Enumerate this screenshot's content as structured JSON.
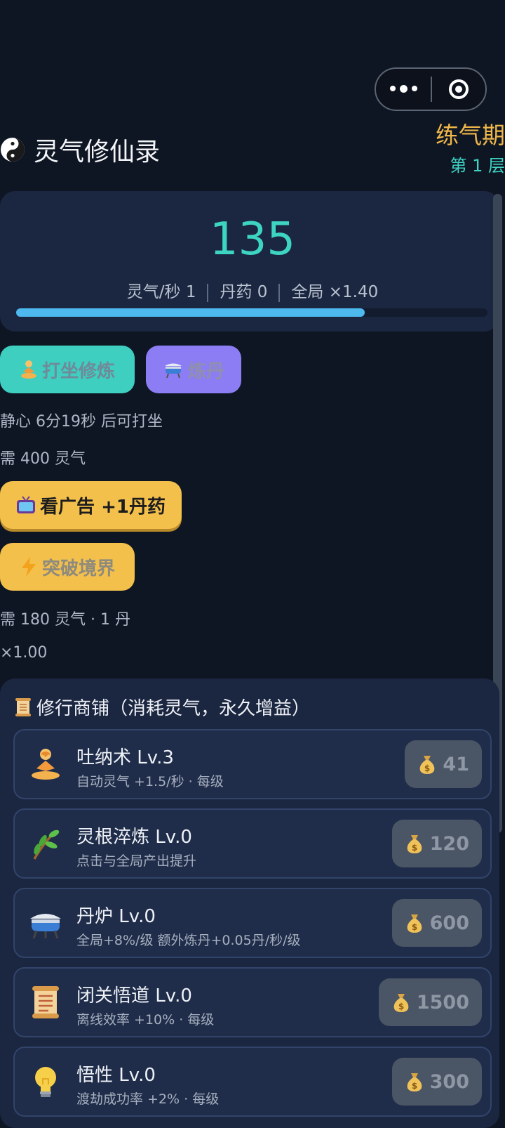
{
  "header": {
    "app_icon": "yin-yang-icon",
    "title": "灵气修仙录",
    "realm": "练气期",
    "layer": "第 1 层"
  },
  "stats": {
    "qi": "135",
    "qi_rate": "灵气/秒 1",
    "pills": "丹药 0",
    "global_multiplier": "全局 ×1.40",
    "progress": 0.74
  },
  "actions": {
    "meditate": "打坐修炼",
    "alchemy": "炼丹",
    "meditate_cooldown": "静心 6分19秒 后可打坐",
    "alchemy_cost": "需 400 灵气",
    "watch_ad": "看广告 +1丹药",
    "breakthrough": "突破境界",
    "breakthrough_cost": "需 180 灵气 · 1 丹",
    "breakthrough_multiplier": "×1.00"
  },
  "shop": {
    "title": "修行商铺（消耗灵气，永久增益）",
    "items": [
      {
        "name": "吐纳术 Lv.3",
        "desc": "自动灵气 +1.5/秒 · 每级",
        "price": "41",
        "icon": "meditation-icon"
      },
      {
        "name": "灵根淬炼 Lv.0",
        "desc": "点击与全局产出提升",
        "price": "120",
        "icon": "herb-icon"
      },
      {
        "name": "丹炉 Lv.0",
        "desc": "全局+8%/级 额外炼丹+0.05丹/秒/级",
        "price": "600",
        "icon": "cauldron-icon"
      },
      {
        "name": "闭关悟道 Lv.0",
        "desc": "离线效率 +10% · 每级",
        "price": "1500",
        "icon": "scroll-icon"
      },
      {
        "name": "悟性 Lv.0",
        "desc": "渡劫成功率 +2% · 每级",
        "price": "300",
        "icon": "lightbulb-icon"
      }
    ]
  },
  "colors": {
    "background": "#0f1623",
    "panel": "#1b2640",
    "accent_teal": "#3dd4c2",
    "accent_gold": "#f3c04c",
    "accent_purple": "#8c7df4",
    "progress": "#4db9ee"
  }
}
